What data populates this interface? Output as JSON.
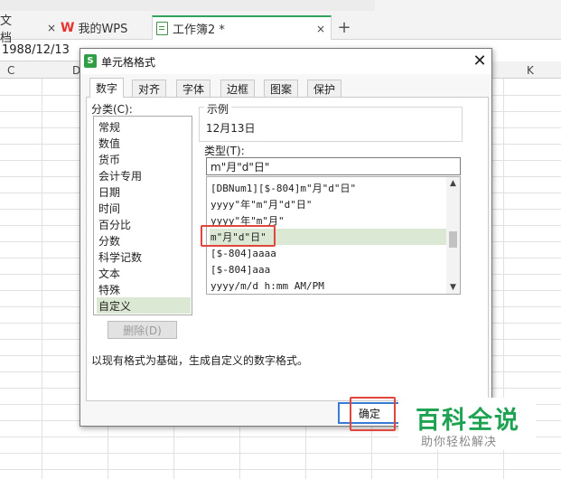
{
  "tabs": [
    {
      "label": "文档"
    },
    {
      "label": "我的WPS"
    },
    {
      "label": "工作簿2 *"
    }
  ],
  "tab_close_glyph": "×",
  "add_tab_glyph": "+",
  "formula_bar": {
    "cell_value": "1988/12/13"
  },
  "columns": [
    {
      "label": "C"
    },
    {
      "label": "D"
    },
    {
      "label": "K"
    }
  ],
  "dialog": {
    "app_icon": "S",
    "title": "单元格格式",
    "close_glyph": "✕",
    "tabs": [
      {
        "label": "数字",
        "active": true
      },
      {
        "label": "对齐"
      },
      {
        "label": "字体"
      },
      {
        "label": "边框"
      },
      {
        "label": "图案"
      },
      {
        "label": "保护"
      }
    ],
    "category_label": "分类(C):",
    "categories": [
      {
        "label": "常规"
      },
      {
        "label": "数值"
      },
      {
        "label": "货币"
      },
      {
        "label": "会计专用"
      },
      {
        "label": "日期"
      },
      {
        "label": "时间"
      },
      {
        "label": "百分比"
      },
      {
        "label": "分数"
      },
      {
        "label": "科学记数"
      },
      {
        "label": "文本"
      },
      {
        "label": "特殊"
      },
      {
        "label": "自定义",
        "selected": true
      }
    ],
    "delete_button": "删除(D)",
    "sample_label": "示例",
    "sample_value": "12月13日",
    "type_label": "类型(T):",
    "type_input_value": "m\"月\"d\"日\"",
    "type_list": [
      {
        "label": "[DBNum1][$-804]m\"月\"d\"日\""
      },
      {
        "label": "yyyy\"年\"m\"月\"d\"日\""
      },
      {
        "label": "yyyy\"年\"m\"月\""
      },
      {
        "label": "m\"月\"d\"日\"",
        "selected": true
      },
      {
        "label": "[$-804]aaaa"
      },
      {
        "label": "[$-804]aaa"
      },
      {
        "label": "yyyy/m/d h:mm AM/PM"
      }
    ],
    "scroll_up": "▲",
    "scroll_down": "▼",
    "hint": "以现有格式为基础，生成自定义的数字格式。",
    "ok_button": "确定"
  },
  "watermark": {
    "title": "百科全说",
    "subtitle": "助你轻松解决"
  },
  "colors": {
    "accent_green": "#31a35a",
    "selection": "#dbe9d4",
    "highlight_red": "#e0463b",
    "button_blue": "#3a7bd5"
  }
}
